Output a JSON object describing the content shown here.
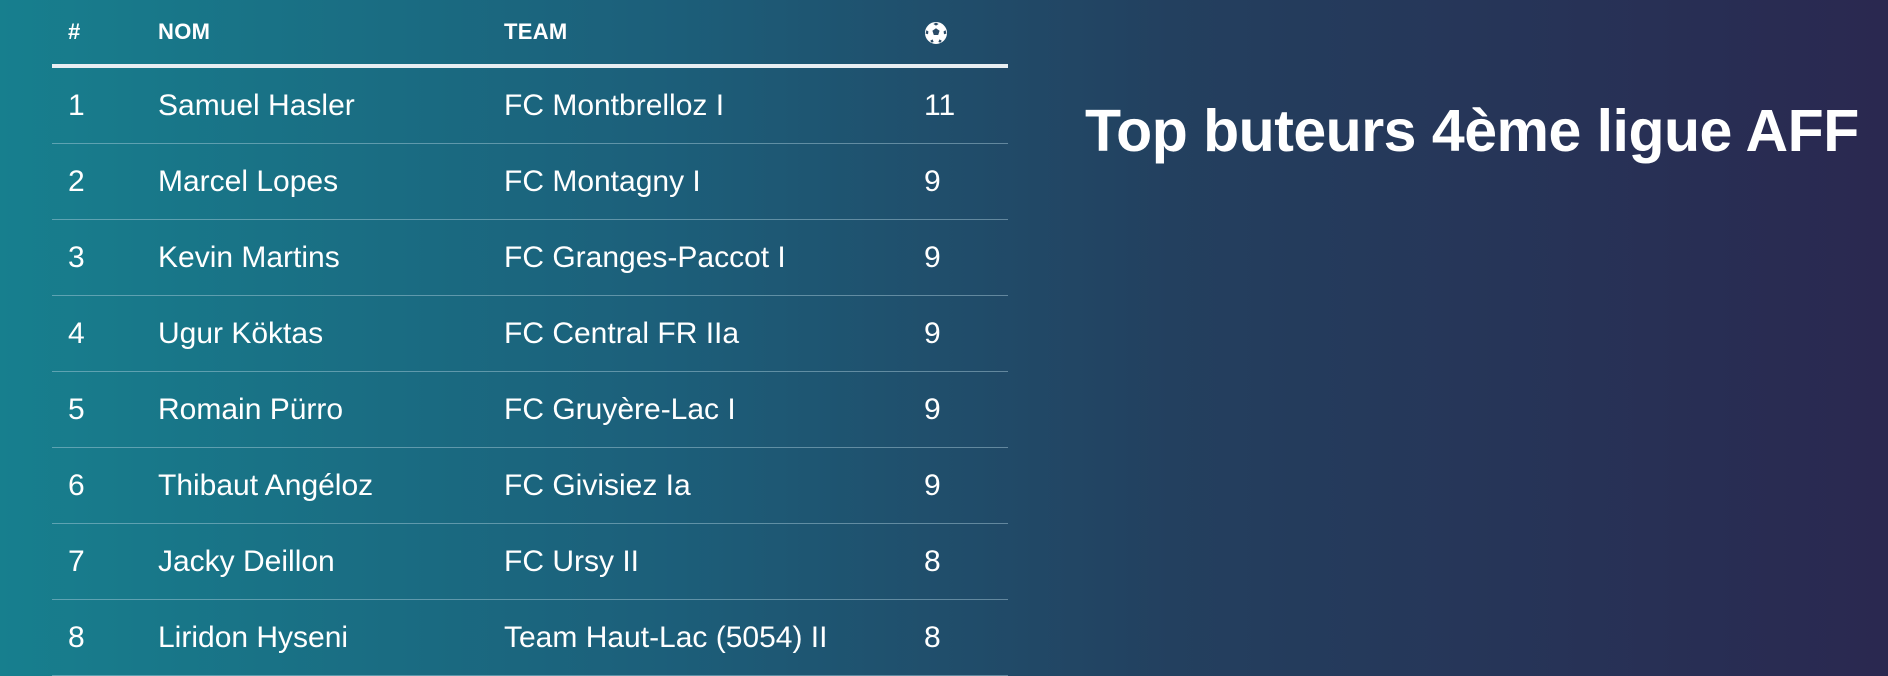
{
  "title": "Top buteurs 4ème ligue AFF",
  "table": {
    "headers": {
      "rank": "#",
      "name": "NOM",
      "team": "TEAM",
      "goals_icon": "soccer-ball-icon"
    },
    "rows": [
      {
        "rank": "1",
        "name": "Samuel Hasler",
        "team": "FC Montbrelloz I",
        "goals": "11"
      },
      {
        "rank": "2",
        "name": "Marcel Lopes",
        "team": "FC Montagny I",
        "goals": "9"
      },
      {
        "rank": "3",
        "name": "Kevin Martins",
        "team": "FC Granges-Paccot I",
        "goals": "9"
      },
      {
        "rank": "4",
        "name": "Ugur Köktas",
        "team": "FC Central FR IIa",
        "goals": "9"
      },
      {
        "rank": "5",
        "name": "Romain Pürro",
        "team": "FC Gruyère-Lac I",
        "goals": "9"
      },
      {
        "rank": "6",
        "name": "Thibaut Angéloz",
        "team": "FC Givisiez Ia",
        "goals": "9"
      },
      {
        "rank": "7",
        "name": "Jacky Deillon",
        "team": "FC Ursy II",
        "goals": "8"
      },
      {
        "rank": "8",
        "name": "Liridon Hyseni",
        "team": "Team Haut-Lac (5054) II",
        "goals": "8"
      }
    ]
  },
  "colors": {
    "gradient_start": "#177f8e",
    "gradient_end": "#2a2850",
    "text": "#ffffff",
    "header_rule": "#e8eef2"
  }
}
